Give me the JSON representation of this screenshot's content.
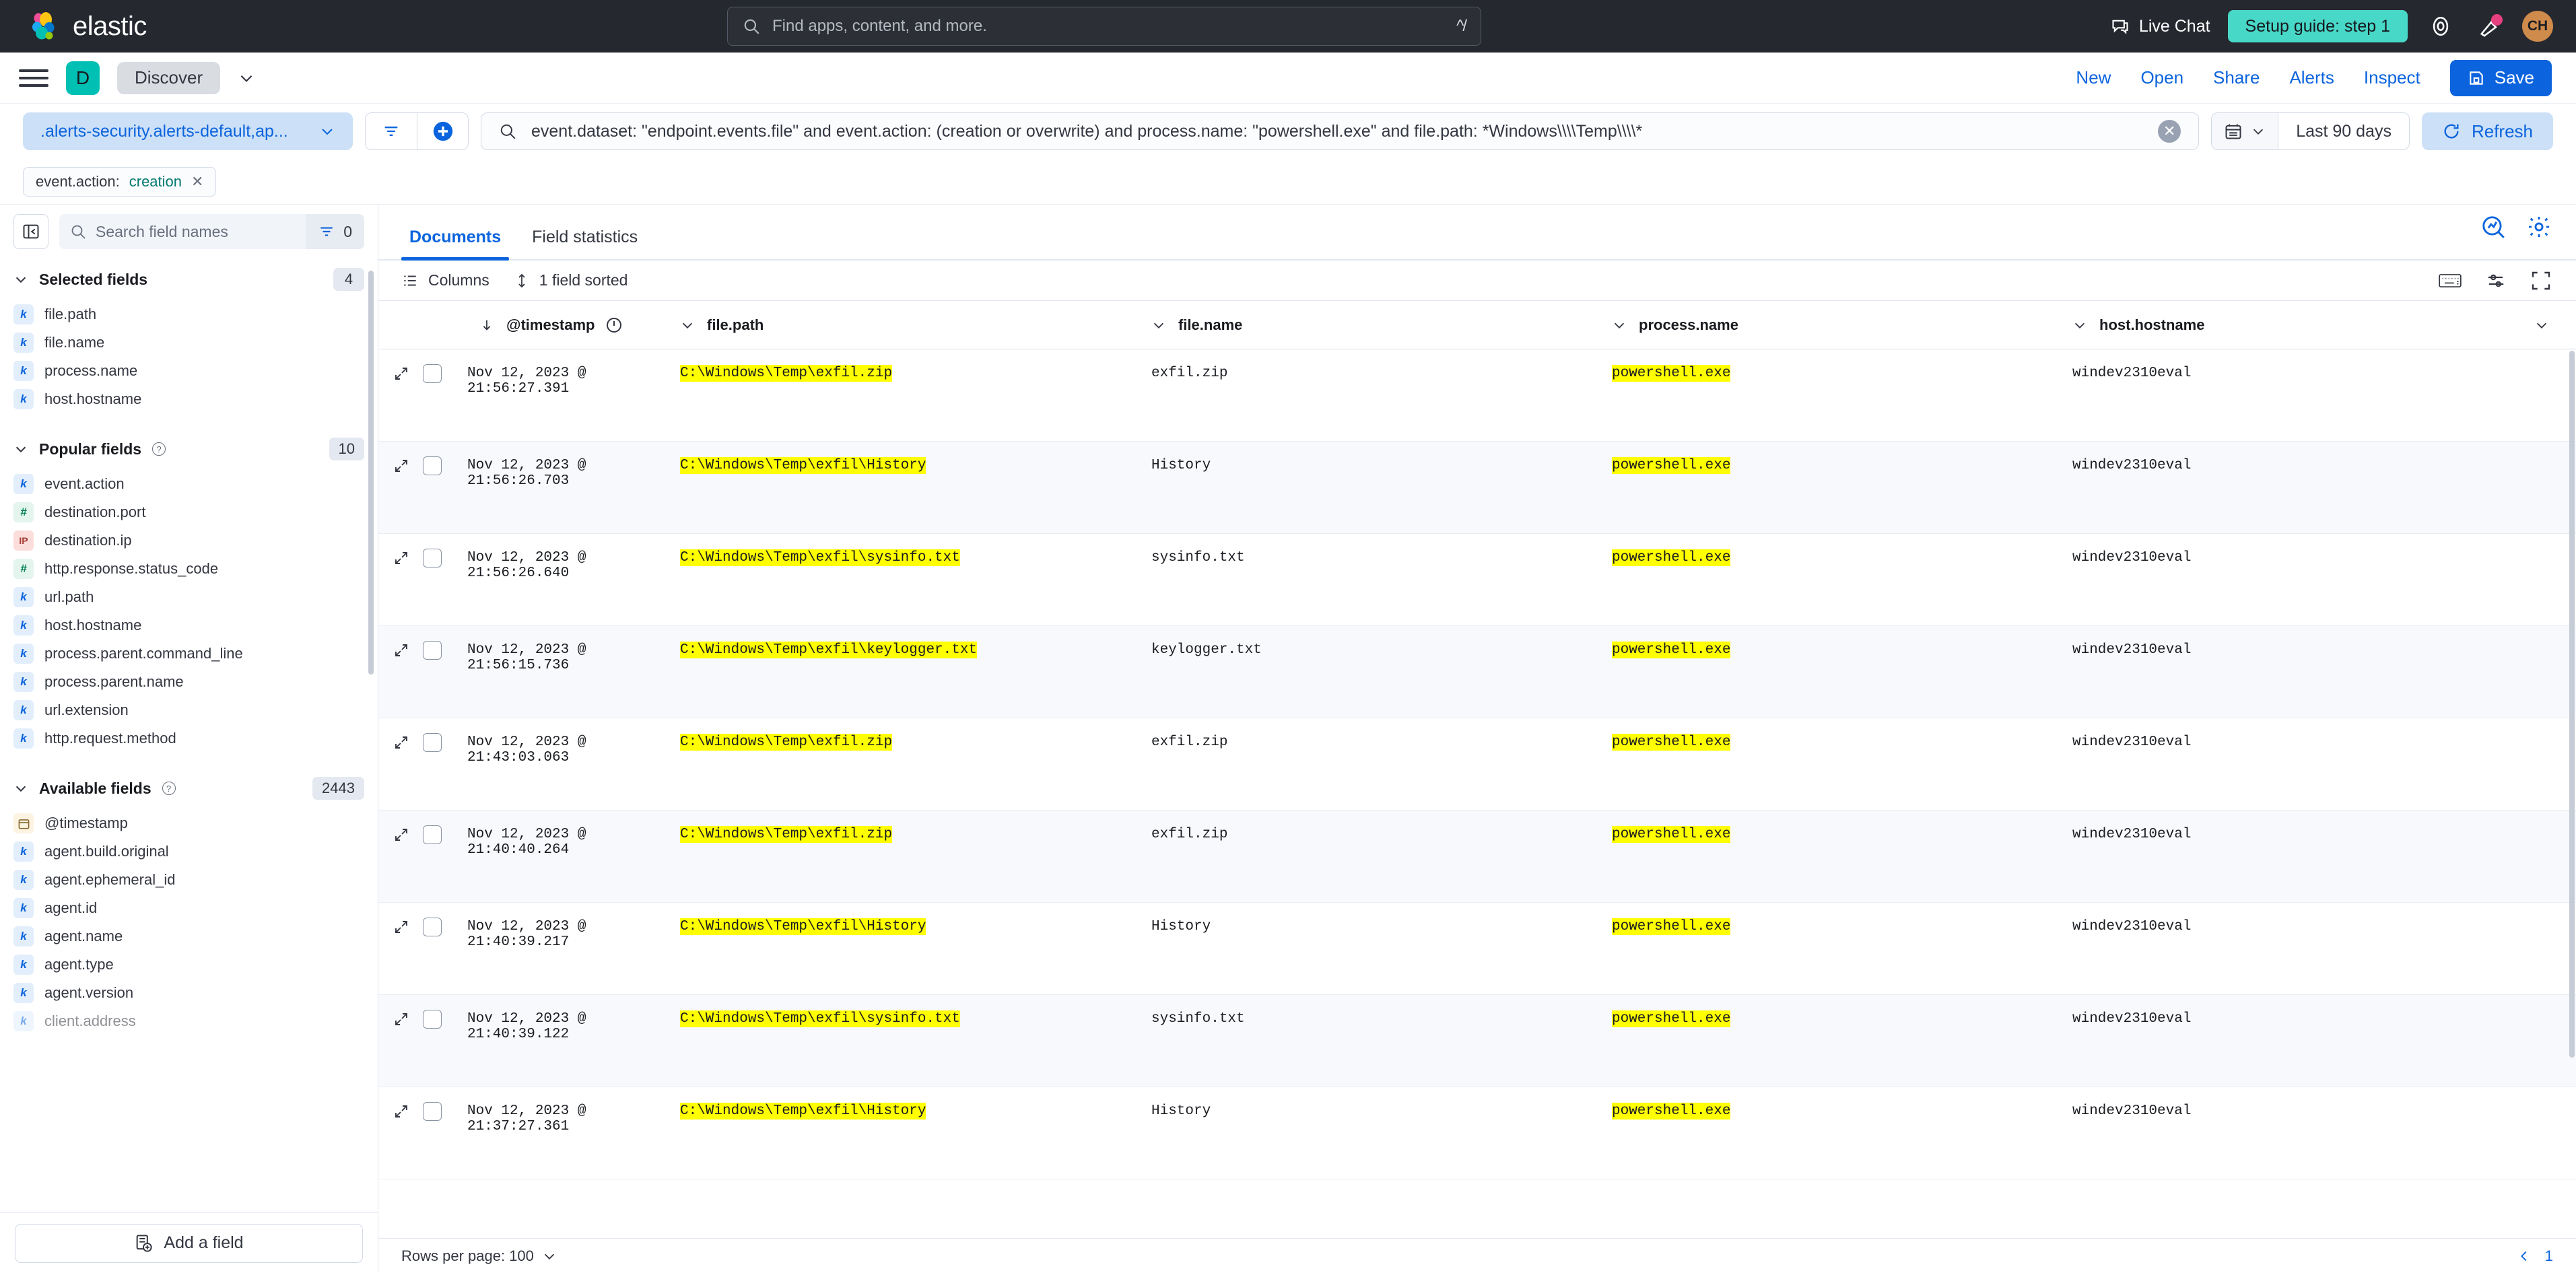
{
  "header": {
    "brand": "elastic",
    "global_search_placeholder": "Find apps, content, and more.",
    "global_search_shortcut": "^/",
    "live_chat": "Live Chat",
    "setup_guide": "Setup guide: step 1",
    "avatar_initials": "CH",
    "accent_teal": "#48d8c8",
    "header_bg": "#25282f"
  },
  "nav": {
    "app_initial": "D",
    "app_name": "Discover",
    "links": [
      "New",
      "Open",
      "Share",
      "Alerts",
      "Inspect"
    ],
    "save_label": "Save",
    "primary_blue": "#0b64dd"
  },
  "query": {
    "data_view": ".alerts-security.alerts-default,ap...",
    "text": "event.dataset: \"endpoint.events.file\" and event.action: (creation or overwrite) and process.name: \"powershell.exe\" and file.path: *Windows\\\\\\\\Temp\\\\\\\\*",
    "time_range": "Last 90 days",
    "refresh_label": "Refresh"
  },
  "filters": [
    {
      "field": "event.action:",
      "value": "creation"
    }
  ],
  "sidebar": {
    "search_placeholder": "Search field names",
    "filter_count": "0",
    "groups": [
      {
        "name": "Selected fields",
        "count": "4",
        "has_help": false,
        "fields": [
          {
            "name": "file.path",
            "type": "k"
          },
          {
            "name": "file.name",
            "type": "k"
          },
          {
            "name": "process.name",
            "type": "k"
          },
          {
            "name": "host.hostname",
            "type": "k"
          }
        ]
      },
      {
        "name": "Popular fields",
        "count": "10",
        "has_help": true,
        "fields": [
          {
            "name": "event.action",
            "type": "k"
          },
          {
            "name": "destination.port",
            "type": "n"
          },
          {
            "name": "destination.ip",
            "type": "ip"
          },
          {
            "name": "http.response.status_code",
            "type": "n"
          },
          {
            "name": "url.path",
            "type": "k"
          },
          {
            "name": "host.hostname",
            "type": "k"
          },
          {
            "name": "process.parent.command_line",
            "type": "k"
          },
          {
            "name": "process.parent.name",
            "type": "k"
          },
          {
            "name": "url.extension",
            "type": "k"
          },
          {
            "name": "http.request.method",
            "type": "k"
          }
        ]
      },
      {
        "name": "Available fields",
        "count": "2443",
        "has_help": true,
        "fields": [
          {
            "name": "@timestamp",
            "type": "date"
          },
          {
            "name": "agent.build.original",
            "type": "k"
          },
          {
            "name": "agent.ephemeral_id",
            "type": "k"
          },
          {
            "name": "agent.id",
            "type": "k"
          },
          {
            "name": "agent.name",
            "type": "k"
          },
          {
            "name": "agent.type",
            "type": "k"
          },
          {
            "name": "agent.version",
            "type": "k"
          },
          {
            "name": "client.address",
            "type": "k"
          }
        ]
      }
    ],
    "add_field_label": "Add a field"
  },
  "main": {
    "tabs": [
      {
        "label": "Documents",
        "active": true
      },
      {
        "label": "Field statistics",
        "active": false
      }
    ],
    "columns_label": "Columns",
    "sort_label": "1 field sorted",
    "rows_per_page_label": "Rows per page: 100",
    "page_number": "1"
  },
  "table": {
    "columns": [
      "@timestamp",
      "file.path",
      "file.name",
      "process.name",
      "host.hostname"
    ],
    "rows": [
      {
        "timestamp": "Nov 12, 2023 @ 21:56:27.391",
        "file_path": "C:\\Windows\\Temp\\exfil.zip",
        "file_name": "exfil.zip",
        "process_name": "powershell.exe",
        "host_hostname": "windev2310eval"
      },
      {
        "timestamp": "Nov 12, 2023 @ 21:56:26.703",
        "file_path": "C:\\Windows\\Temp\\exfil\\History",
        "file_name": "History",
        "process_name": "powershell.exe",
        "host_hostname": "windev2310eval"
      },
      {
        "timestamp": "Nov 12, 2023 @ 21:56:26.640",
        "file_path": "C:\\Windows\\Temp\\exfil\\sysinfo.txt",
        "file_name": "sysinfo.txt",
        "process_name": "powershell.exe",
        "host_hostname": "windev2310eval"
      },
      {
        "timestamp": "Nov 12, 2023 @ 21:56:15.736",
        "file_path": "C:\\Windows\\Temp\\exfil\\keylogger.txt",
        "file_name": "keylogger.txt",
        "process_name": "powershell.exe",
        "host_hostname": "windev2310eval"
      },
      {
        "timestamp": "Nov 12, 2023 @ 21:43:03.063",
        "file_path": "C:\\Windows\\Temp\\exfil.zip",
        "file_name": "exfil.zip",
        "process_name": "powershell.exe",
        "host_hostname": "windev2310eval"
      },
      {
        "timestamp": "Nov 12, 2023 @ 21:40:40.264",
        "file_path": "C:\\Windows\\Temp\\exfil.zip",
        "file_name": "exfil.zip",
        "process_name": "powershell.exe",
        "host_hostname": "windev2310eval"
      },
      {
        "timestamp": "Nov 12, 2023 @ 21:40:39.217",
        "file_path": "C:\\Windows\\Temp\\exfil\\History",
        "file_name": "History",
        "process_name": "powershell.exe",
        "host_hostname": "windev2310eval"
      },
      {
        "timestamp": "Nov 12, 2023 @ 21:40:39.122",
        "file_path": "C:\\Windows\\Temp\\exfil\\sysinfo.txt",
        "file_name": "sysinfo.txt",
        "process_name": "powershell.exe",
        "host_hostname": "windev2310eval"
      },
      {
        "timestamp": "Nov 12, 2023 @ 21:37:27.361",
        "file_path": "C:\\Windows\\Temp\\exfil\\History",
        "file_name": "History",
        "process_name": "powershell.exe",
        "host_hostname": "windev2310eval"
      }
    ]
  }
}
